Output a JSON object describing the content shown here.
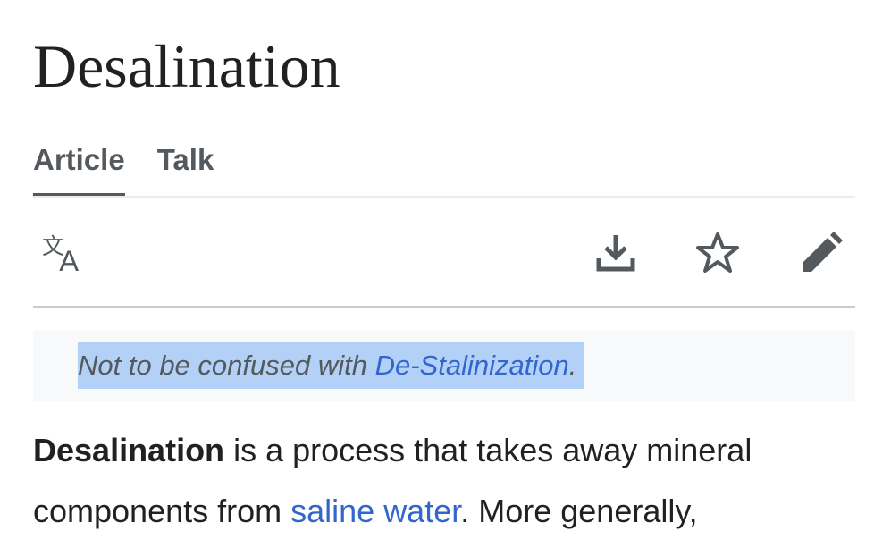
{
  "page": {
    "title": "Desalination"
  },
  "tabs": [
    {
      "label": "Article",
      "active": true
    },
    {
      "label": "Talk",
      "active": false
    }
  ],
  "toolbar": {
    "icons": [
      "language-icon",
      "download-icon",
      "star-icon",
      "edit-icon"
    ]
  },
  "hatnote": {
    "prefix": "Not to be confused with ",
    "link": "De-Stalinization",
    "suffix": "."
  },
  "paragraph": {
    "bold_term": "Desalination",
    "text1": " is a process that takes away mineral components from ",
    "link": "saline water",
    "text2": ". More generally,"
  },
  "colors": {
    "link": "#3366cc",
    "selection": "#b3d1f6",
    "hatnote_bg": "#f8f9fa",
    "icon": "#54595d"
  }
}
